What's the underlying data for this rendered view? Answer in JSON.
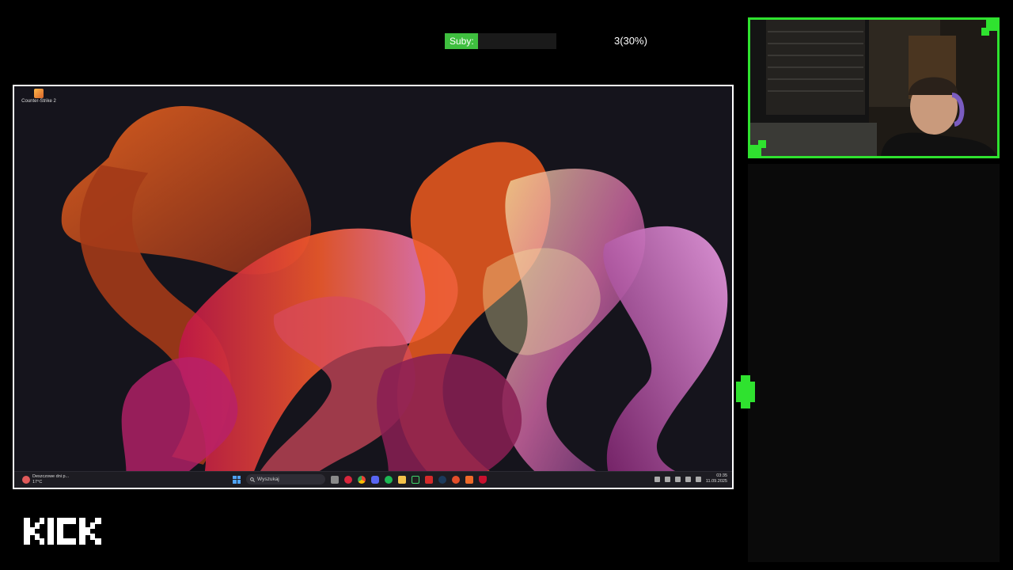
{
  "goal": {
    "label": "Suby:",
    "count_text": "3(30%)",
    "progress": 0.3
  },
  "desktop": {
    "icon_label": "Counter-Strike 2",
    "taskbar": {
      "weather_line1": "Deszczowe dni p...",
      "weather_line2": "17°C",
      "search_placeholder": "Wyszukaj",
      "time": "03:35",
      "date": "11.09.2025"
    }
  },
  "colors": {
    "accent": "#2fe22f",
    "goal_fill": "#3fbf3f"
  },
  "brand": {
    "logo_text": "KICK"
  }
}
